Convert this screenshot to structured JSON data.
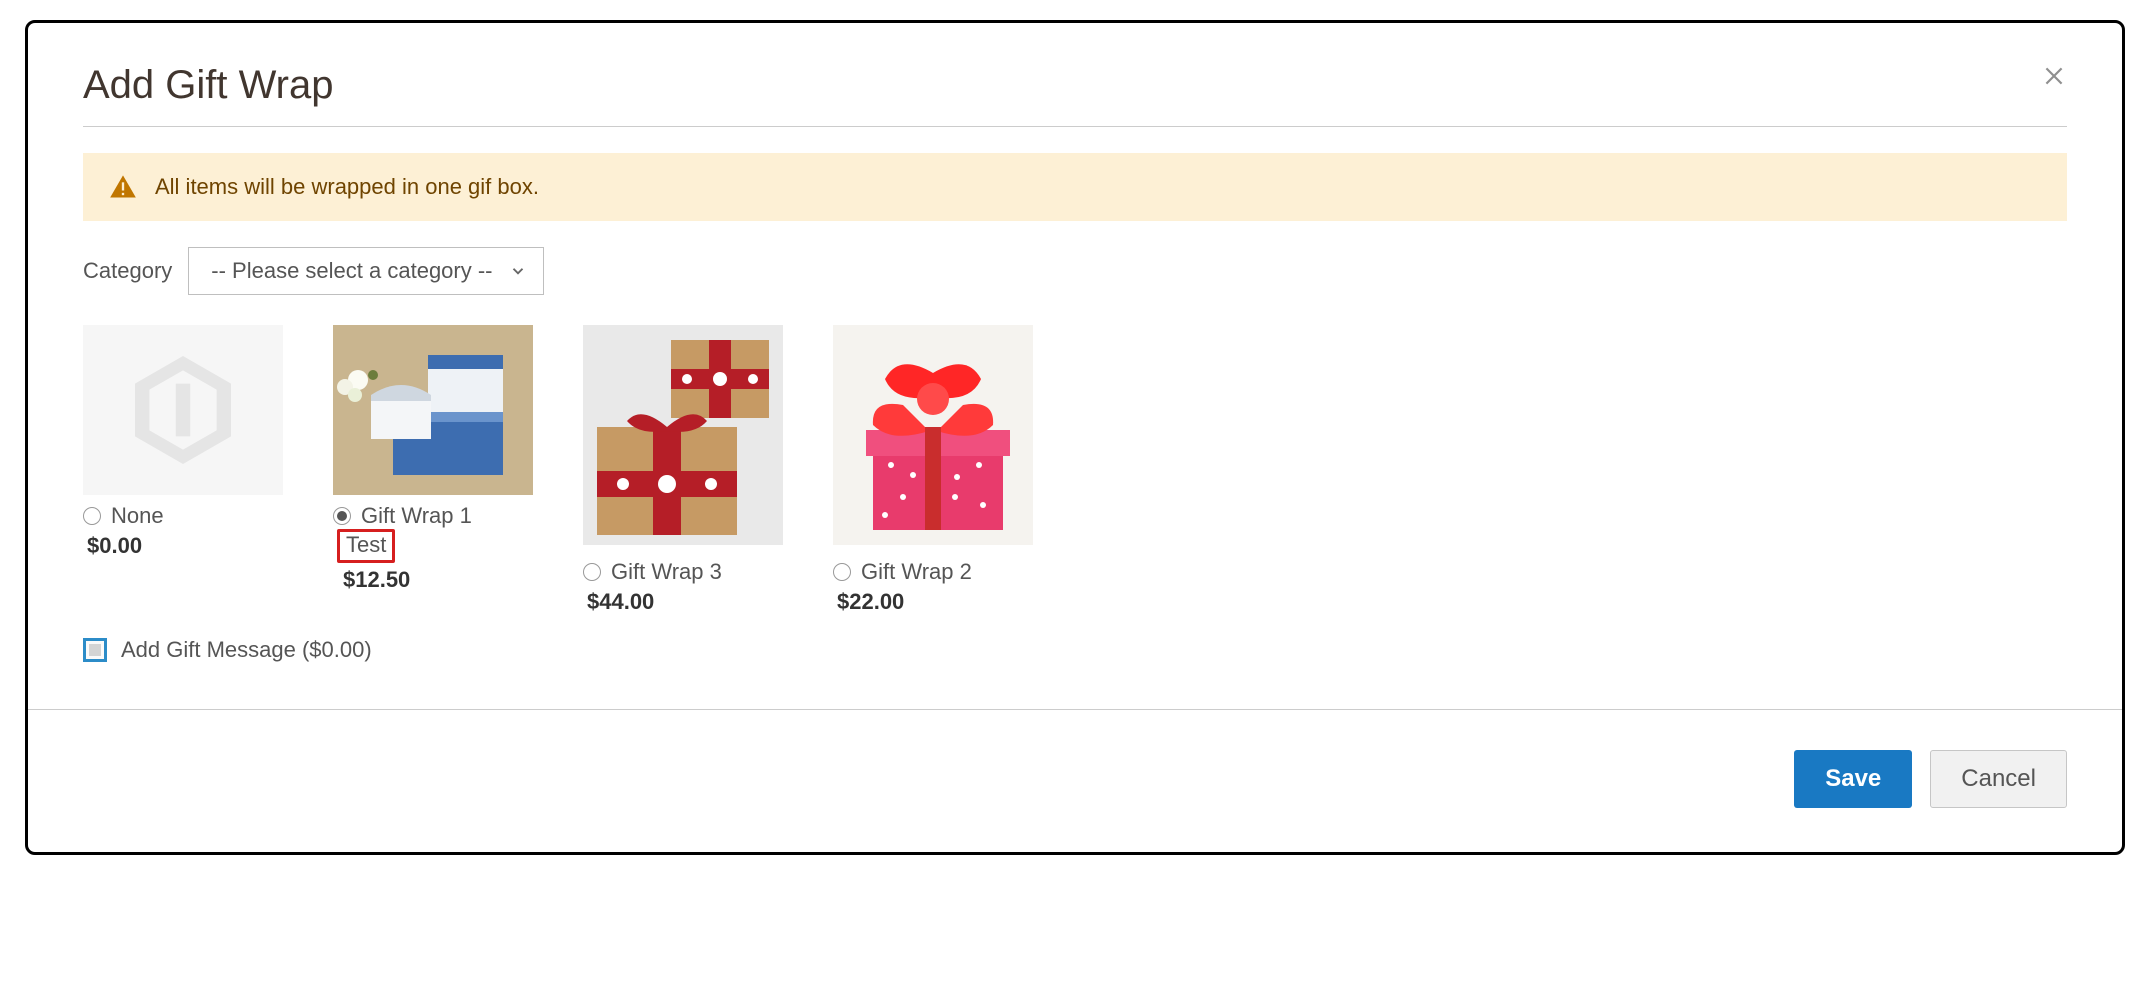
{
  "modal": {
    "title": "Add Gift Wrap"
  },
  "alert": {
    "text": "All items will be wrapped in one gif box."
  },
  "category": {
    "label": "Category",
    "selected": "-- Please select a category --"
  },
  "wraps": [
    {
      "name": "None",
      "sublabel": "",
      "price": "$0.00",
      "selected": false,
      "highlighted": false
    },
    {
      "name": "Gift Wrap 1",
      "sublabel": "Test",
      "price": "$12.50",
      "selected": true,
      "highlighted": true
    },
    {
      "name": "Gift Wrap 3",
      "sublabel": "",
      "price": "$44.00",
      "selected": false,
      "highlighted": false
    },
    {
      "name": "Gift Wrap 2",
      "sublabel": "",
      "price": "$22.00",
      "selected": false,
      "highlighted": false
    }
  ],
  "gift_message": {
    "label": "Add Gift Message ($0.00)"
  },
  "buttons": {
    "save": "Save",
    "cancel": "Cancel"
  }
}
